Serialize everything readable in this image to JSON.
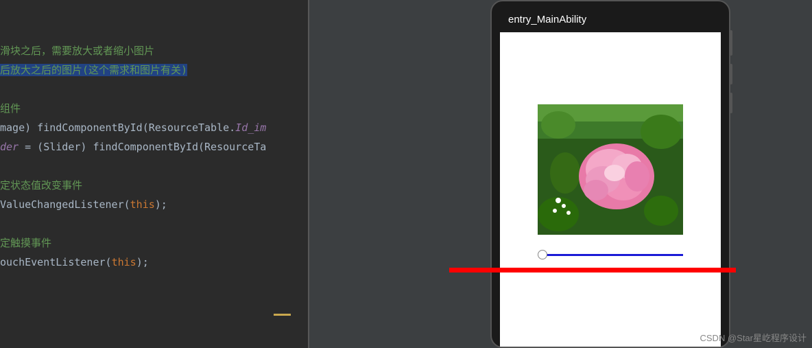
{
  "code": {
    "line1": "滑块之后，需要放大或者缩小图片",
    "line2": "后放大之后的图片(这个需求和图片有关)",
    "line3_prefix": "组件",
    "line4_a": "mage) findComponentById(ResourceTable.",
    "line4_b": "Id_im",
    "line5_a": "der",
    "line5_b": " = (Slider) findComponentById(ResourceTa",
    "line6": "定状态值改变事件",
    "line7_a": "ValueChangedListener(",
    "line7_b": "this",
    "line7_c": ");",
    "line8": "定触摸事件",
    "line9_a": "ouchEventListener(",
    "line9_b": "this",
    "line9_c": ");"
  },
  "phone": {
    "title": "entry_MainAbility"
  },
  "watermark": "CSDN @Star星屹程序设计"
}
